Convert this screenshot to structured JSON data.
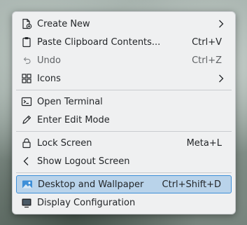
{
  "menu": {
    "items": [
      {
        "label": "Create New",
        "icon": "new-document-icon",
        "submenu": true
      },
      {
        "label": "Paste Clipboard Contents...",
        "shortcut": "Ctrl+V",
        "icon": "clipboard-icon"
      },
      {
        "label": "Undo",
        "shortcut": "Ctrl+Z",
        "icon": "undo-icon",
        "disabled": true
      },
      {
        "label": "Icons",
        "icon": "grid-icon",
        "submenu": true
      },
      {
        "label": "Open Terminal",
        "icon": "terminal-icon"
      },
      {
        "label": "Enter Edit Mode",
        "icon": "pencil-icon"
      },
      {
        "label": "Lock Screen",
        "shortcut": "Meta+L",
        "icon": "lock-icon"
      },
      {
        "label": "Show Logout Screen",
        "icon": "chevron-left-icon"
      },
      {
        "label": "Desktop and Wallpaper",
        "shortcut": "Ctrl+Shift+D",
        "icon": "wallpaper-icon",
        "highlighted": true
      },
      {
        "label": "Display Configuration",
        "icon": "display-icon"
      }
    ]
  },
  "colors": {
    "menu_background": "#eff0f1",
    "highlight_fill": "#b9d3ea",
    "highlight_border": "#3d8fd8",
    "text": "#232629"
  }
}
